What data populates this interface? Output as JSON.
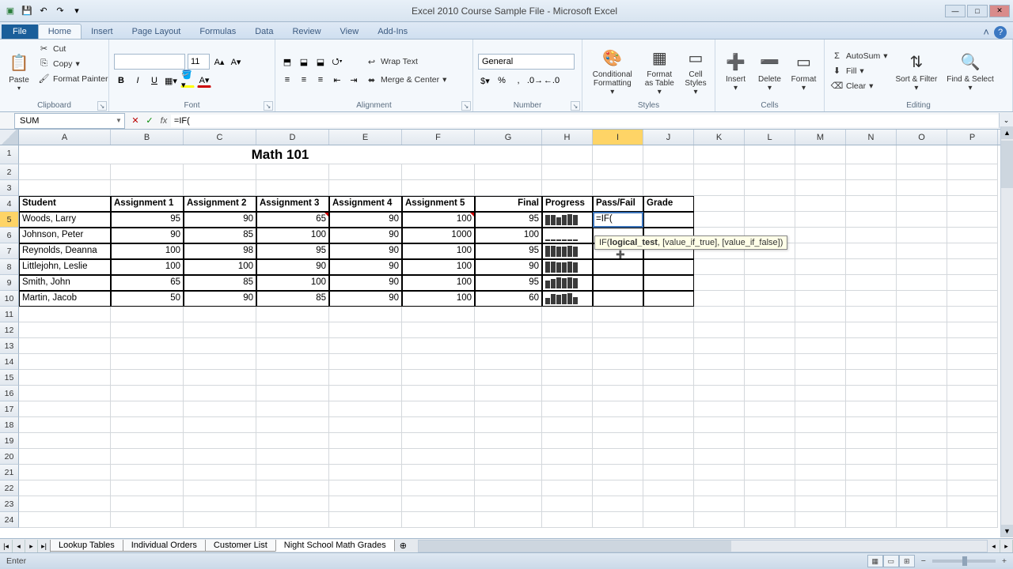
{
  "app": {
    "title": "Excel 2010 Course Sample File - Microsoft Excel"
  },
  "qat": {
    "save": "💾",
    "undo": "↶",
    "redo": "↷"
  },
  "tabs": {
    "file": "File",
    "home": "Home",
    "insert": "Insert",
    "pageLayout": "Page Layout",
    "formulas": "Formulas",
    "data": "Data",
    "review": "Review",
    "view": "View",
    "addins": "Add-Ins"
  },
  "ribbon": {
    "clipboard": {
      "label": "Clipboard",
      "paste": "Paste",
      "cut": "Cut",
      "copy": "Copy",
      "formatPainter": "Format Painter"
    },
    "font": {
      "label": "Font",
      "size": "11",
      "bold": "B",
      "italic": "I",
      "underline": "U"
    },
    "alignment": {
      "label": "Alignment",
      "wrap": "Wrap Text",
      "merge": "Merge & Center"
    },
    "number": {
      "label": "Number",
      "format": "General"
    },
    "styles": {
      "label": "Styles",
      "conditional": "Conditional Formatting",
      "table": "Format as Table",
      "cellStyles": "Cell Styles"
    },
    "cells": {
      "label": "Cells",
      "insert": "Insert",
      "delete": "Delete",
      "format": "Format"
    },
    "editing": {
      "label": "Editing",
      "autosum": "AutoSum",
      "fill": "Fill",
      "clear": "Clear",
      "sort": "Sort & Filter",
      "find": "Find & Select"
    }
  },
  "formulaBar": {
    "nameBox": "SUM",
    "formula": "=IF("
  },
  "funcHint": {
    "name": "IF",
    "curr": "logical_test",
    "arg2": "[value_if_true]",
    "arg3": "[value_if_false]"
  },
  "columns": [
    "A",
    "B",
    "C",
    "D",
    "E",
    "F",
    "G",
    "H",
    "I",
    "J",
    "K",
    "L",
    "M",
    "N",
    "O",
    "P"
  ],
  "sheet": {
    "title": "Math 101",
    "headers": {
      "student": "Student",
      "a1": "Assignment 1",
      "a2": "Assignment 2",
      "a3": "Assignment 3",
      "a4": "Assignment 4",
      "a5": "Assignment 5",
      "final": "Final",
      "progress": "Progress",
      "passfail": "Pass/Fail",
      "grade": "Grade"
    },
    "rows": [
      {
        "student": "Woods, Larry",
        "a1": "95",
        "a2": "90",
        "a3": "65",
        "a4": "90",
        "a5": "100",
        "final": "95",
        "spark": [
          95,
          90,
          65,
          90,
          100,
          95
        ]
      },
      {
        "student": "Johnson, Peter",
        "a1": "90",
        "a2": "85",
        "a3": "100",
        "a4": "90",
        "a5": "1000",
        "final": "100",
        "spark": "dashed"
      },
      {
        "student": "Reynolds, Deanna",
        "a1": "100",
        "a2": "98",
        "a3": "95",
        "a4": "90",
        "a5": "100",
        "final": "95",
        "spark": [
          100,
          98,
          95,
          90,
          100,
          95
        ]
      },
      {
        "student": "Littlejohn, Leslie",
        "a1": "100",
        "a2": "100",
        "a3": "90",
        "a4": "90",
        "a5": "100",
        "final": "90",
        "spark": [
          100,
          100,
          90,
          90,
          100,
          90
        ]
      },
      {
        "student": "Smith, John",
        "a1": "65",
        "a2": "85",
        "a3": "100",
        "a4": "90",
        "a5": "100",
        "final": "95",
        "spark": [
          65,
          85,
          100,
          90,
          100,
          95
        ]
      },
      {
        "student": "Martin, Jacob",
        "a1": "50",
        "a2": "90",
        "a3": "85",
        "a4": "90",
        "a5": "100",
        "final": "60",
        "spark": [
          50,
          90,
          85,
          90,
          100,
          60
        ]
      }
    ]
  },
  "editingCell": {
    "value": "=IF("
  },
  "sheetTabs": {
    "t1": "Lookup Tables",
    "t2": "Individual Orders",
    "t3": "Customer List",
    "t4": "Night School Math Grades"
  },
  "status": {
    "mode": "Enter"
  }
}
